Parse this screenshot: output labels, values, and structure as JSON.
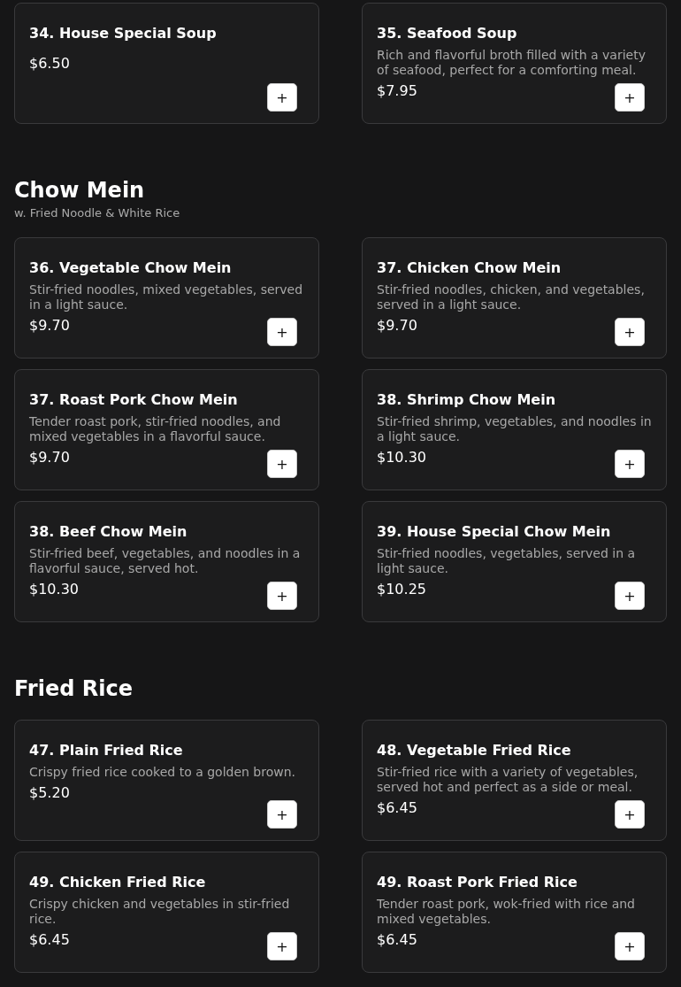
{
  "sections": [
    {
      "items": [
        {
          "name": "34. House Special Soup",
          "price": "$6.50",
          "button": "+"
        },
        {
          "name": "35. Seafood Soup",
          "description": "Rich and flavorful broth filled with a variety of seafood, perfect for a comforting meal.",
          "price": "$7.95",
          "button": "+"
        }
      ]
    },
    {
      "title": "Chow Mein",
      "subtitle": "w. Fried Noodle & White Rice",
      "items": [
        {
          "name": "36. Vegetable Chow Mein",
          "description": "Stir-fried noodles, mixed vegetables, served in a light sauce.",
          "price": "$9.70",
          "button": "+"
        },
        {
          "name": "37. Chicken Chow Mein",
          "description": "Stir-fried noodles, chicken, and vegetables, served in a light sauce.",
          "price": "$9.70",
          "button": "+"
        },
        {
          "name": "37. Roast Pork Chow Mein",
          "description": "Tender roast pork, stir-fried noodles, and mixed vegetables in a flavorful sauce.",
          "price": "$9.70",
          "button": "+"
        },
        {
          "name": "38. Shrimp Chow Mein",
          "description": "Stir-fried shrimp, vegetables, and noodles in a light sauce.",
          "price": "$10.30",
          "button": "+"
        },
        {
          "name": "38. Beef Chow Mein",
          "description": "Stir-fried beef, vegetables, and noodles in a flavorful sauce, served hot.",
          "price": "$10.30",
          "button": "+"
        },
        {
          "name": "39. House Special Chow Mein",
          "description": "Stir-fried noodles, vegetables, served in a light sauce.",
          "price": "$10.25",
          "button": "+"
        }
      ]
    },
    {
      "title": "Fried Rice",
      "items": [
        {
          "name": "47. Plain Fried Rice",
          "description": "Crispy fried rice cooked to a golden brown.",
          "price": "$5.20",
          "button": "+"
        },
        {
          "name": "48. Vegetable Fried Rice",
          "description": "Stir-fried rice with a variety of vegetables, served hot and perfect as a side or meal.",
          "price": "$6.45",
          "button": "+"
        },
        {
          "name": "49. Chicken Fried Rice",
          "description": "Crispy chicken and vegetables in stir-fried rice.",
          "price": "$6.45",
          "button": "+"
        },
        {
          "name": "49. Roast Pork Fried Rice",
          "description": "Tender roast pork, wok-fried with rice and mixed vegetables.",
          "price": "$6.45",
          "button": "+"
        }
      ]
    }
  ]
}
